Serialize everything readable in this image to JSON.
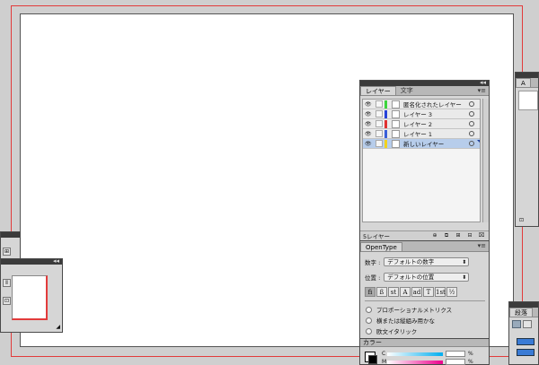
{
  "layers_panel": {
    "tabs": [
      "レイヤー",
      "文字"
    ],
    "active_tab": 0,
    "rows": [
      {
        "name": "匿名化されたレイヤー",
        "color": "#3cd43c",
        "selected": false
      },
      {
        "name": "レイヤー 3",
        "color": "#2742d9",
        "selected": false
      },
      {
        "name": "レイヤー 2",
        "color": "#e03030",
        "selected": false
      },
      {
        "name": "レイヤー 1",
        "color": "#3a5fd9",
        "selected": false
      },
      {
        "name": "新しいレイヤー",
        "color": "#f2d21e",
        "selected": true
      }
    ],
    "count_label": "5レイヤー",
    "eye_icon": "eye-icon",
    "menu_glyph": "▾≡",
    "collapse_glyph": "◂◂"
  },
  "opentype_panel": {
    "title": "OpenType",
    "figure_label": "数字 :",
    "figure_value": "デフォルトの数字",
    "position_label": "位置 :",
    "position_value": "デフォルトの位置",
    "glyphs": [
      "fi",
      "ß",
      "st",
      "A",
      "ad",
      "T",
      "1st",
      "½"
    ],
    "options": [
      "プロポーショナルメトリクス",
      "横または縦組み用かな",
      "欧文イタリック"
    ]
  },
  "color_panel": {
    "title": "カラー",
    "channels": [
      {
        "label": "C",
        "gradient": "linear-gradient(to right,#fff,#00aeef)"
      },
      {
        "label": "M",
        "gradient": "linear-gradient(to right,#fff,#ec008c)"
      }
    ],
    "pct": "%"
  },
  "paragraph_panel": {
    "title": "段落"
  },
  "colors": {
    "bleed": "#e23b3b",
    "panel_bg": "#d6d6d6",
    "selected_row": "#b7cdeb"
  }
}
